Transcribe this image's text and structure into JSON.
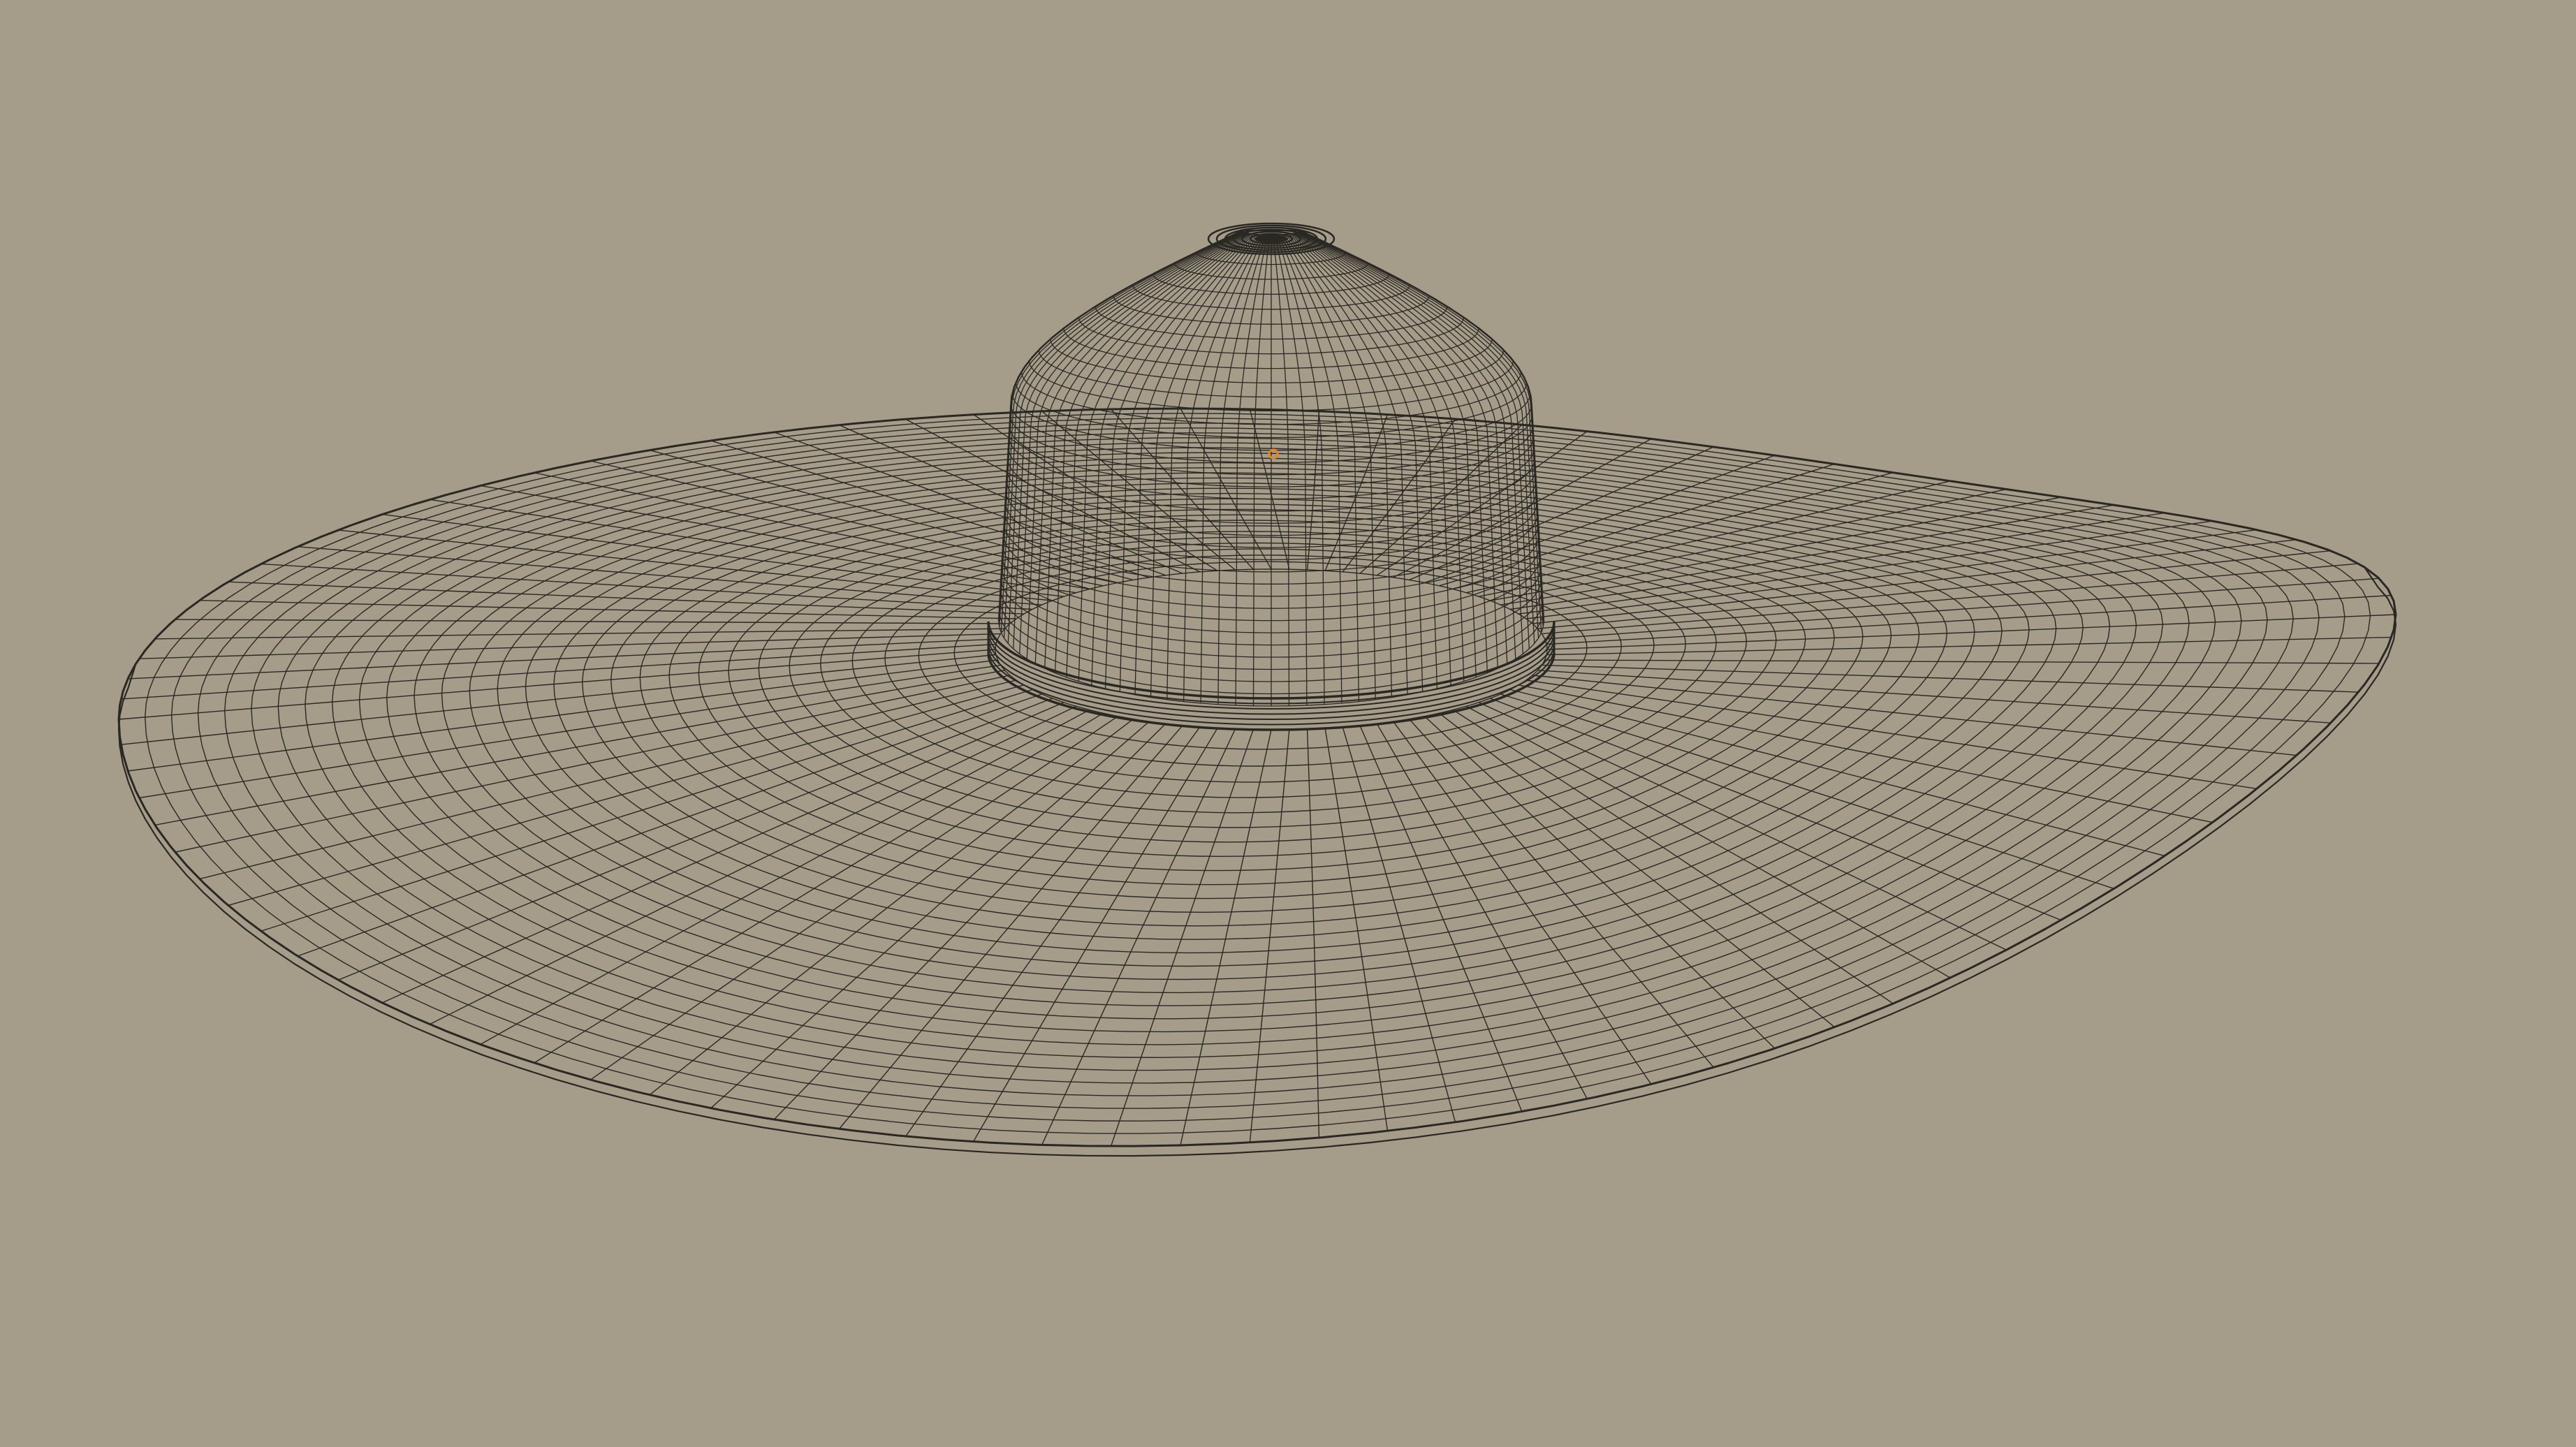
{
  "viewport": {
    "background_color": "#a69c8a",
    "shading": "wireframe",
    "object": "sun-hat-mesh",
    "wire_color": "#2a2823",
    "origin_marker_color": "#e08a1e"
  }
}
